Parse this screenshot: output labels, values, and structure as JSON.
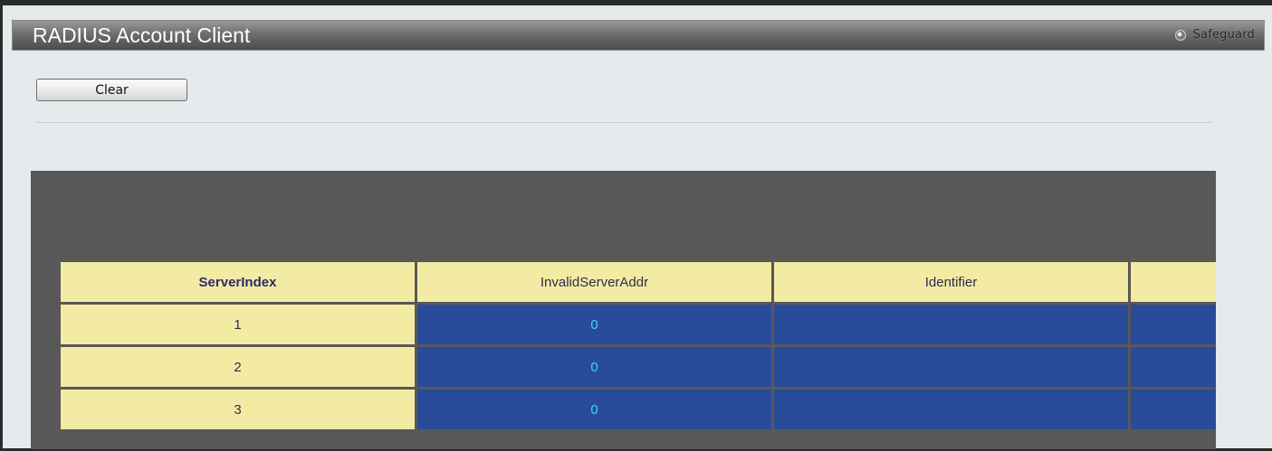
{
  "header": {
    "title": "RADIUS Account Client",
    "safeguard_label": "Safeguard",
    "safeguard_icon": "radio-indicator-icon"
  },
  "toolbar": {
    "clear_label": "Clear"
  },
  "colors": {
    "header_cell": "#f3eba3",
    "data_cell": "#2a4a9a",
    "data_text": "#3fd1ff",
    "panel": "#585858"
  },
  "table": {
    "columns": [
      "ServerIndex",
      "InvalidServerAddr",
      "Identifier",
      ""
    ],
    "rows": [
      {
        "server_index": "1",
        "invalid_server_addr": "0",
        "identifier": "",
        "extra": ""
      },
      {
        "server_index": "2",
        "invalid_server_addr": "0",
        "identifier": "",
        "extra": ""
      },
      {
        "server_index": "3",
        "invalid_server_addr": "0",
        "identifier": "",
        "extra": ""
      }
    ]
  }
}
